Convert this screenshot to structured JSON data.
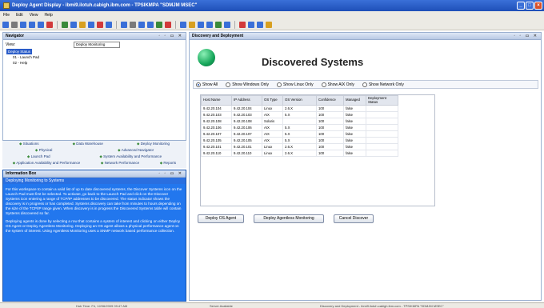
{
  "window": {
    "title": "Deploy Agent Display - ibmi9.ilotuh.cabigh.ibm.com - TPSIKMPA \"SDMJM MSEC\""
  },
  "menu": [
    "File",
    "Edit",
    "View",
    "Help"
  ],
  "toolbar_colors": [
    "#3a6fd8",
    "#7a7a7a",
    "#3a6fd8",
    "#3a6fd8",
    "#3a6fd8",
    "#d23a3a",
    "#3a8a3a",
    "#3a6fd8",
    "#d8a020",
    "#3a6fd8",
    "#d23a3a",
    "#3a6fd8",
    "#3a6fd8",
    "#7a7a7a",
    "#3a6fd8",
    "#3a6fd8",
    "#3a8a3a",
    "#d23a3a",
    "#3a6fd8",
    "#d8a020",
    "#3a6fd8",
    "#3a6fd8",
    "#3a8a3a",
    "#3a6fd8",
    "#d23a3a",
    "#3a6fd8",
    "#3a6fd8",
    "#d8a020"
  ],
  "navigator": {
    "title": "Navigator",
    "view_label": "View:",
    "view_value": "Deploy Monitoring",
    "tree": [
      "Deploy Status",
      "01 - Launch Pad",
      "02 - Help"
    ]
  },
  "nav_tabs": {
    "row1": [
      "Situations",
      "Data Warehouse",
      "Deploy Monitoring"
    ],
    "row2": [
      "Physical",
      "Advanced Navigator"
    ],
    "row3": [
      "Launch Pad",
      "System Availability and Performance"
    ],
    "row4": [
      "Application Availability and Performance",
      "Network Performance",
      "Reports"
    ]
  },
  "info": {
    "title": "Information Box",
    "subtitle": "Deploying Monitoring to Systems",
    "p1": "For this workspace to contain a valid list of up to date discovered systems, the Discover Systems icon on the Launch Pad must first be selected. To activate, go back to the Launch Pad and click on the Discover Systems icon entering a range of TCP/IP addresses to be discovered. The status indicator shows the discovery is in progress or has completed. Systems discovery can take from minutes to hours depending on the size of the TCP/IP range given. When discovery is in progress the Discovered Systems table will contain Systems discovered so far.",
    "p2": "Deploying agents is done by selecting a row that contains a system of interest and clicking on either Deploy OS Agent or Deploy Agentless Monitoring. Deploying an OS agent allows a physical performance agent on the system of interest. Using Agentless Monitoring uses a SNMP network based performance collection."
  },
  "main": {
    "title": "Discovery and Deployment",
    "heading": "Discovered Systems",
    "filters": [
      "Show All",
      "Show Windows Only",
      "Show Linux Only",
      "Show AIX Only",
      "Show Network Only"
    ],
    "filter_selected": 0,
    "columns": [
      "Host Name",
      "IP Address",
      "OS Type",
      "OS Version",
      "Confidence",
      "Managed",
      "Deployment Status"
    ],
    "rows": [
      [
        "9.42.20.104",
        "9.42.20.104",
        "Linux",
        "2.6.X",
        "100",
        "false",
        ""
      ],
      [
        "9.42.20.103",
        "9.42.20.103",
        "AIX",
        "5.X",
        "100",
        "false",
        ""
      ],
      [
        "9.42.20.108",
        "9.42.20.108",
        "Solaris",
        "",
        "100",
        "false",
        ""
      ],
      [
        "9.42.20.106",
        "9.42.20.106",
        "AIX",
        "5.X",
        "100",
        "false",
        ""
      ],
      [
        "9.42.20.107",
        "9.42.20.107",
        "AIX",
        "5.X",
        "100",
        "false",
        ""
      ],
      [
        "9.42.20.105",
        "9.42.20.105",
        "AIX",
        "5.X",
        "100",
        "false",
        ""
      ],
      [
        "9.42.20.101",
        "9.42.20.101",
        "Linux",
        "2.6.X",
        "100",
        "false",
        ""
      ],
      [
        "9.42.20.110",
        "9.42.20.110",
        "Linux",
        "2.6.X",
        "100",
        "false",
        ""
      ]
    ],
    "buttons": {
      "deploy_os": "Deploy OS Agent",
      "deploy_agentless": "Deploy Agentless Monitoring",
      "cancel": "Cancel Discover"
    }
  },
  "status": {
    "left": "Hub Time: Fri, 12/06/2009 09:47 AM",
    "middle": "Server Available",
    "right": "Discovery and Deployment - ibmi9.ilotuh.cabigh.ibm.com - TPSIKMPA \"SDMJM MSEC\""
  }
}
